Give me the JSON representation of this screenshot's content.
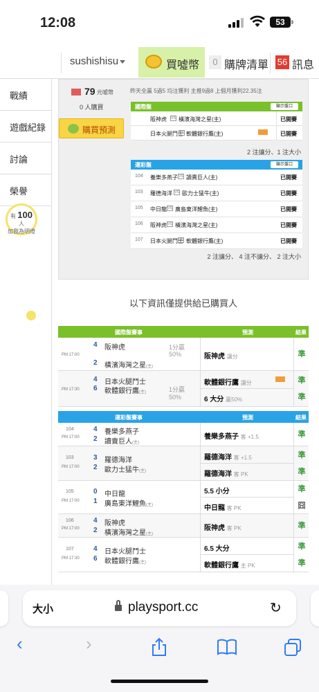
{
  "status": {
    "time": "12:08",
    "battery": "53"
  },
  "topbar": {
    "username": "sushishisu",
    "buy_coin_label": "買噓幣",
    "cart_count": "0",
    "cart_label": "購牌清單",
    "msg_count": "56",
    "msg_label": "訊息"
  },
  "sidebar": {
    "items": [
      {
        "label": "戰績"
      },
      {
        "label": "遊戲紀錄"
      },
      {
        "label": "討論"
      },
      {
        "label": "榮譽"
      }
    ],
    "bulb_prefix": "有",
    "bulb_count": "100",
    "bulb_suffix": "人",
    "bulb_line2": "加我為明燈"
  },
  "prediction": {
    "price": "79",
    "price_unit": "元噓幣",
    "buyers": "0 人購買",
    "buy_button": "購買預測",
    "record": "昨天全贏 5過5 均注獲利 主推9過8 上個月獲利22.35注",
    "intl_header": "國際盤",
    "show_odds": "顯示盤口",
    "intl_rows": [
      {
        "team1": "阪神虎",
        "team2": "橫濱海灣之星(主)",
        "status": "已開賽"
      },
      {
        "team1": "日本火腿鬥士",
        "team2": "軟體銀行鷹(主)",
        "status": "已開賽"
      }
    ],
    "intl_summary": "2 注讓分、1 注大小",
    "lottery_header": "運彩盤",
    "lottery_rows": [
      {
        "no": "104",
        "team1": "養樂多燕子",
        "team2": "讀賣巨人(主)",
        "status": "已開賽"
      },
      {
        "no": "103",
        "team1": "羅德海洋",
        "team2": "歐力士猛牛(主)",
        "status": "已開賽"
      },
      {
        "no": "105",
        "team1": "中日龍",
        "team2": "廣島東洋鯉魚(主)",
        "status": "已開賽"
      },
      {
        "no": "106",
        "team1": "阪神虎",
        "team2": "橫濱海灣之星(主)",
        "status": "已開賽"
      },
      {
        "no": "107",
        "team1": "日本火腿鬥士",
        "team2": "軟體銀行鷹(主)",
        "status": "已開賽"
      }
    ],
    "lottery_summary": "2 注讓分、 4 注不讓分、 2 注大小"
  },
  "info_text": "以下資訊僅提供給已購買人",
  "intl_table": {
    "col_match": "國際盤賽事",
    "col_pred": "預測",
    "col_result": "結果",
    "rows": [
      {
        "time": "PM 17:00",
        "s1": "4",
        "t1": "阪神虎",
        "s2": "2",
        "t2": "橫濱海灣之星",
        "home_mark": "(主)",
        "line1": "1分贏",
        "line2": "50%",
        "preds": [
          {
            "text": "阪神虎",
            "sub": "讓分",
            "result": "準"
          }
        ]
      },
      {
        "time": "PM 17:30",
        "s1": "4",
        "t1": "日本火腿鬥士",
        "s2": "6",
        "t2": "軟體銀行鷹",
        "home_mark": "(主)",
        "line1": "1分贏",
        "line2": "50%",
        "preds": [
          {
            "text": "軟體銀行鷹",
            "sub": "讓分",
            "result": "準"
          },
          {
            "text": "6 大分",
            "sub": "贏50%",
            "result": "準"
          }
        ]
      }
    ]
  },
  "lottery_table": {
    "col_match": "運彩盤賽事",
    "col_pred": "預測",
    "col_result": "結果",
    "rows": [
      {
        "no": "104",
        "time": "PM 17:00",
        "s1": "4",
        "t1": "養樂多燕子",
        "s2": "2",
        "t2": "讀賣巨人",
        "home_mark": "(主)",
        "preds": [
          {
            "text": "養樂多燕子",
            "sub": "客 +1.5",
            "result": "準"
          }
        ]
      },
      {
        "no": "103",
        "time": "PM 17:00",
        "s1": "3",
        "t1": "羅德海洋",
        "s2": "2",
        "t2": "歐力士猛牛",
        "home_mark": "(主)",
        "preds": [
          {
            "text": "羅德海洋",
            "sub": "客 +1.5",
            "result": "準"
          },
          {
            "text": "羅德海洋",
            "sub": "客 PK",
            "result": "準"
          }
        ]
      },
      {
        "no": "105",
        "time": "PM 17:00",
        "s1": "0",
        "t1": "中日龍",
        "s2": "1",
        "t2": "廣島東洋鯉魚",
        "home_mark": "(主)",
        "preds": [
          {
            "text": "5.5 小分",
            "sub": "",
            "result": "準"
          },
          {
            "text": "中日龍",
            "sub": "客 PK",
            "result": "囧"
          }
        ]
      },
      {
        "no": "106",
        "time": "PM 17:00",
        "s1": "4",
        "t1": "阪神虎",
        "s2": "2",
        "t2": "橫濱海灣之星",
        "home_mark": "(主)",
        "preds": [
          {
            "text": "阪神虎",
            "sub": "客 PK",
            "result": "準"
          }
        ]
      },
      {
        "no": "107",
        "time": "PM 17:30",
        "s1": "4",
        "t1": "日本火腿鬥士",
        "s2": "6",
        "t2": "軟體銀行鷹",
        "home_mark": "(主)",
        "preds": [
          {
            "text": "6.5 大分",
            "sub": "",
            "result": "準"
          },
          {
            "text": "軟體銀行鷹",
            "sub": "主 PK",
            "result": "準"
          }
        ]
      }
    ]
  },
  "browser": {
    "text_size": "大小",
    "url": "playsport.cc"
  },
  "colors": {
    "green": "#79c02a",
    "blue": "#29a3e6",
    "win": "#3a9a3a"
  }
}
